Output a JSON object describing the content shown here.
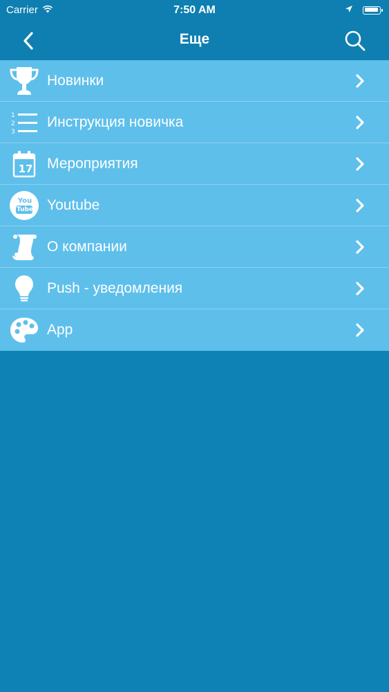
{
  "status_bar": {
    "carrier": "Carrier",
    "time": "7:50 AM"
  },
  "nav": {
    "title": "Еще"
  },
  "menu": {
    "items": [
      {
        "label": "Новинки",
        "icon": "trophy-icon"
      },
      {
        "label": "Инструкция новичка",
        "icon": "numbered-list-icon"
      },
      {
        "label": "Мероприятия",
        "icon": "calendar-icon"
      },
      {
        "label": "Youtube",
        "icon": "youtube-icon"
      },
      {
        "label": "О компании",
        "icon": "scroll-icon"
      },
      {
        "label": "Push - уведомления",
        "icon": "lightbulb-icon"
      },
      {
        "label": "App",
        "icon": "palette-icon"
      }
    ]
  },
  "calendar_icon_day": "17",
  "youtube_icon_text": {
    "line1": "You",
    "line2": "Tube"
  },
  "colors": {
    "background": "#0e82b4",
    "bar": "#0e7fb0",
    "menu_row": "#5ebfeb",
    "separator": "#8fd1f0",
    "text": "#ffffff"
  }
}
